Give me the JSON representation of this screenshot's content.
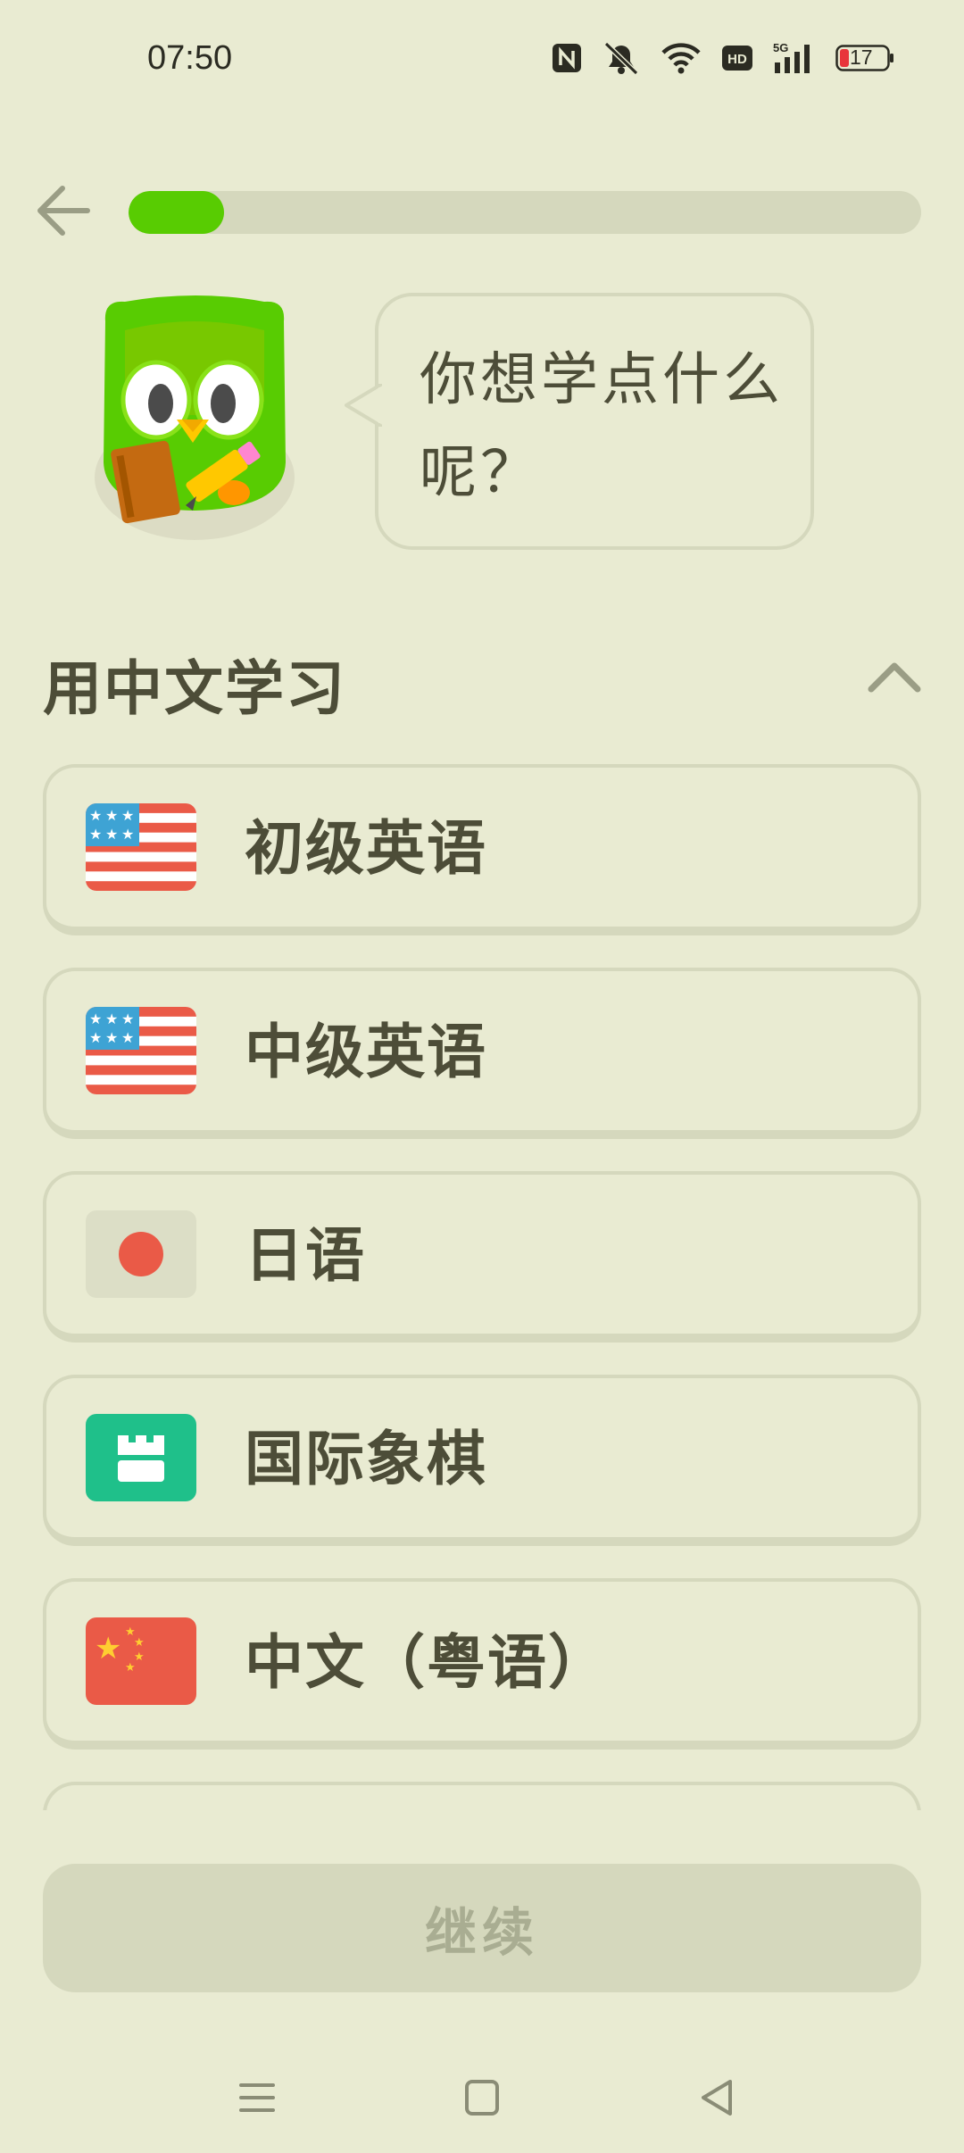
{
  "status_bar": {
    "time": "07:50",
    "battery_level": "17",
    "icons": [
      "nfc-icon",
      "mute-icon",
      "wifi-icon",
      "hd-icon",
      "5g-signal-icon",
      "battery-icon"
    ]
  },
  "header": {
    "back_icon": "arrow-left-icon",
    "progress_fraction": 0.12
  },
  "speech": {
    "text": "你想学点什么呢？"
  },
  "section": {
    "title": "用中文学习",
    "collapse_icon": "chevron-up-icon"
  },
  "courses": [
    {
      "label": "初级英语",
      "flag": "us-flag"
    },
    {
      "label": "中级英语",
      "flag": "us-flag"
    },
    {
      "label": "日语",
      "flag": "japan-flag"
    },
    {
      "label": "国际象棋",
      "flag": "chess-rook-icon"
    },
    {
      "label": "中文（粤语）",
      "flag": "china-flag"
    }
  ],
  "continue": {
    "label": "继续"
  },
  "nav": {
    "icons": [
      "menu-icon",
      "home-icon",
      "back-triangle-icon"
    ]
  },
  "colors": {
    "background": "#e9ebd2",
    "progress": "#58cc02",
    "border": "#d5d8bd",
    "text": "#4d4d38",
    "button_disabled": "#d5d8bd",
    "button_text_disabled": "#a9ad92"
  }
}
